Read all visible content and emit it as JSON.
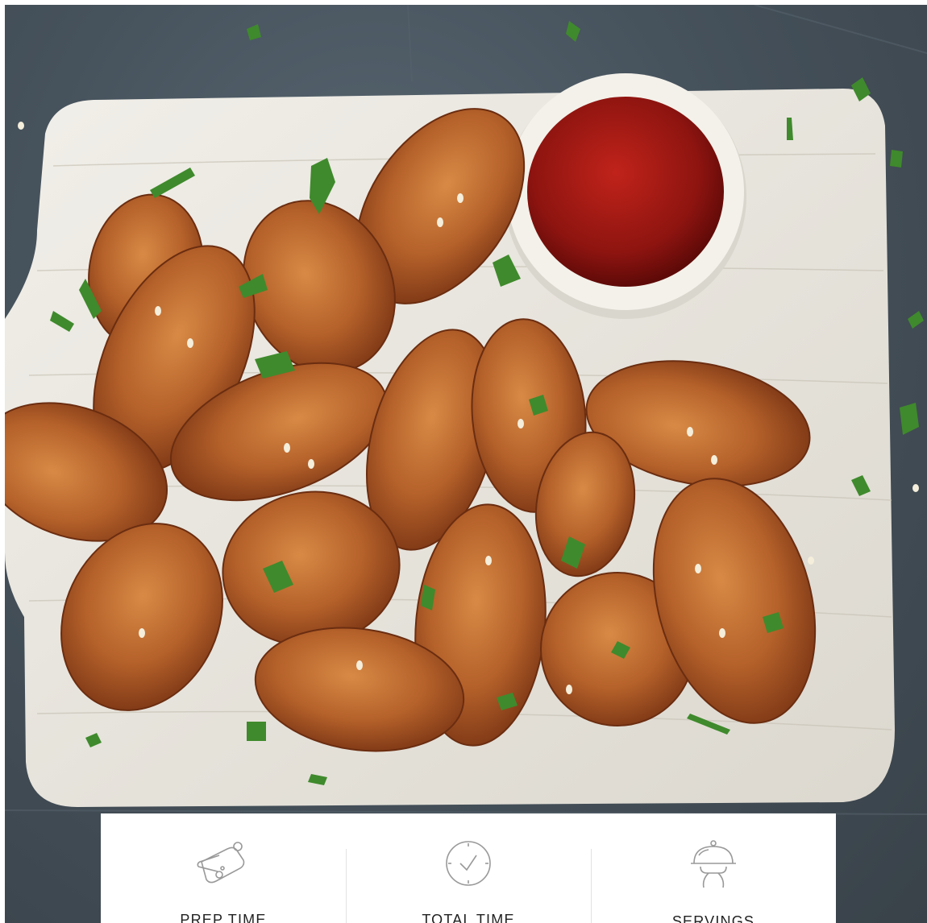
{
  "hero_image": {
    "icon": "chicken-wings-photo",
    "colors": {
      "slate_background": "#46525c",
      "board": "#e9e6df",
      "wing": "#b5612a",
      "sauce": "#8e1410",
      "bowl": "#f3f1ea",
      "parsley": "#3f8a2c"
    }
  },
  "recipe_info": {
    "items": [
      {
        "icon": "cutting-board-icon",
        "label": "PREP TIME"
      },
      {
        "icon": "clock-icon",
        "label": "TOTAL TIME"
      },
      {
        "icon": "cloche-platter-icon",
        "label": "SERVINGS"
      }
    ]
  }
}
